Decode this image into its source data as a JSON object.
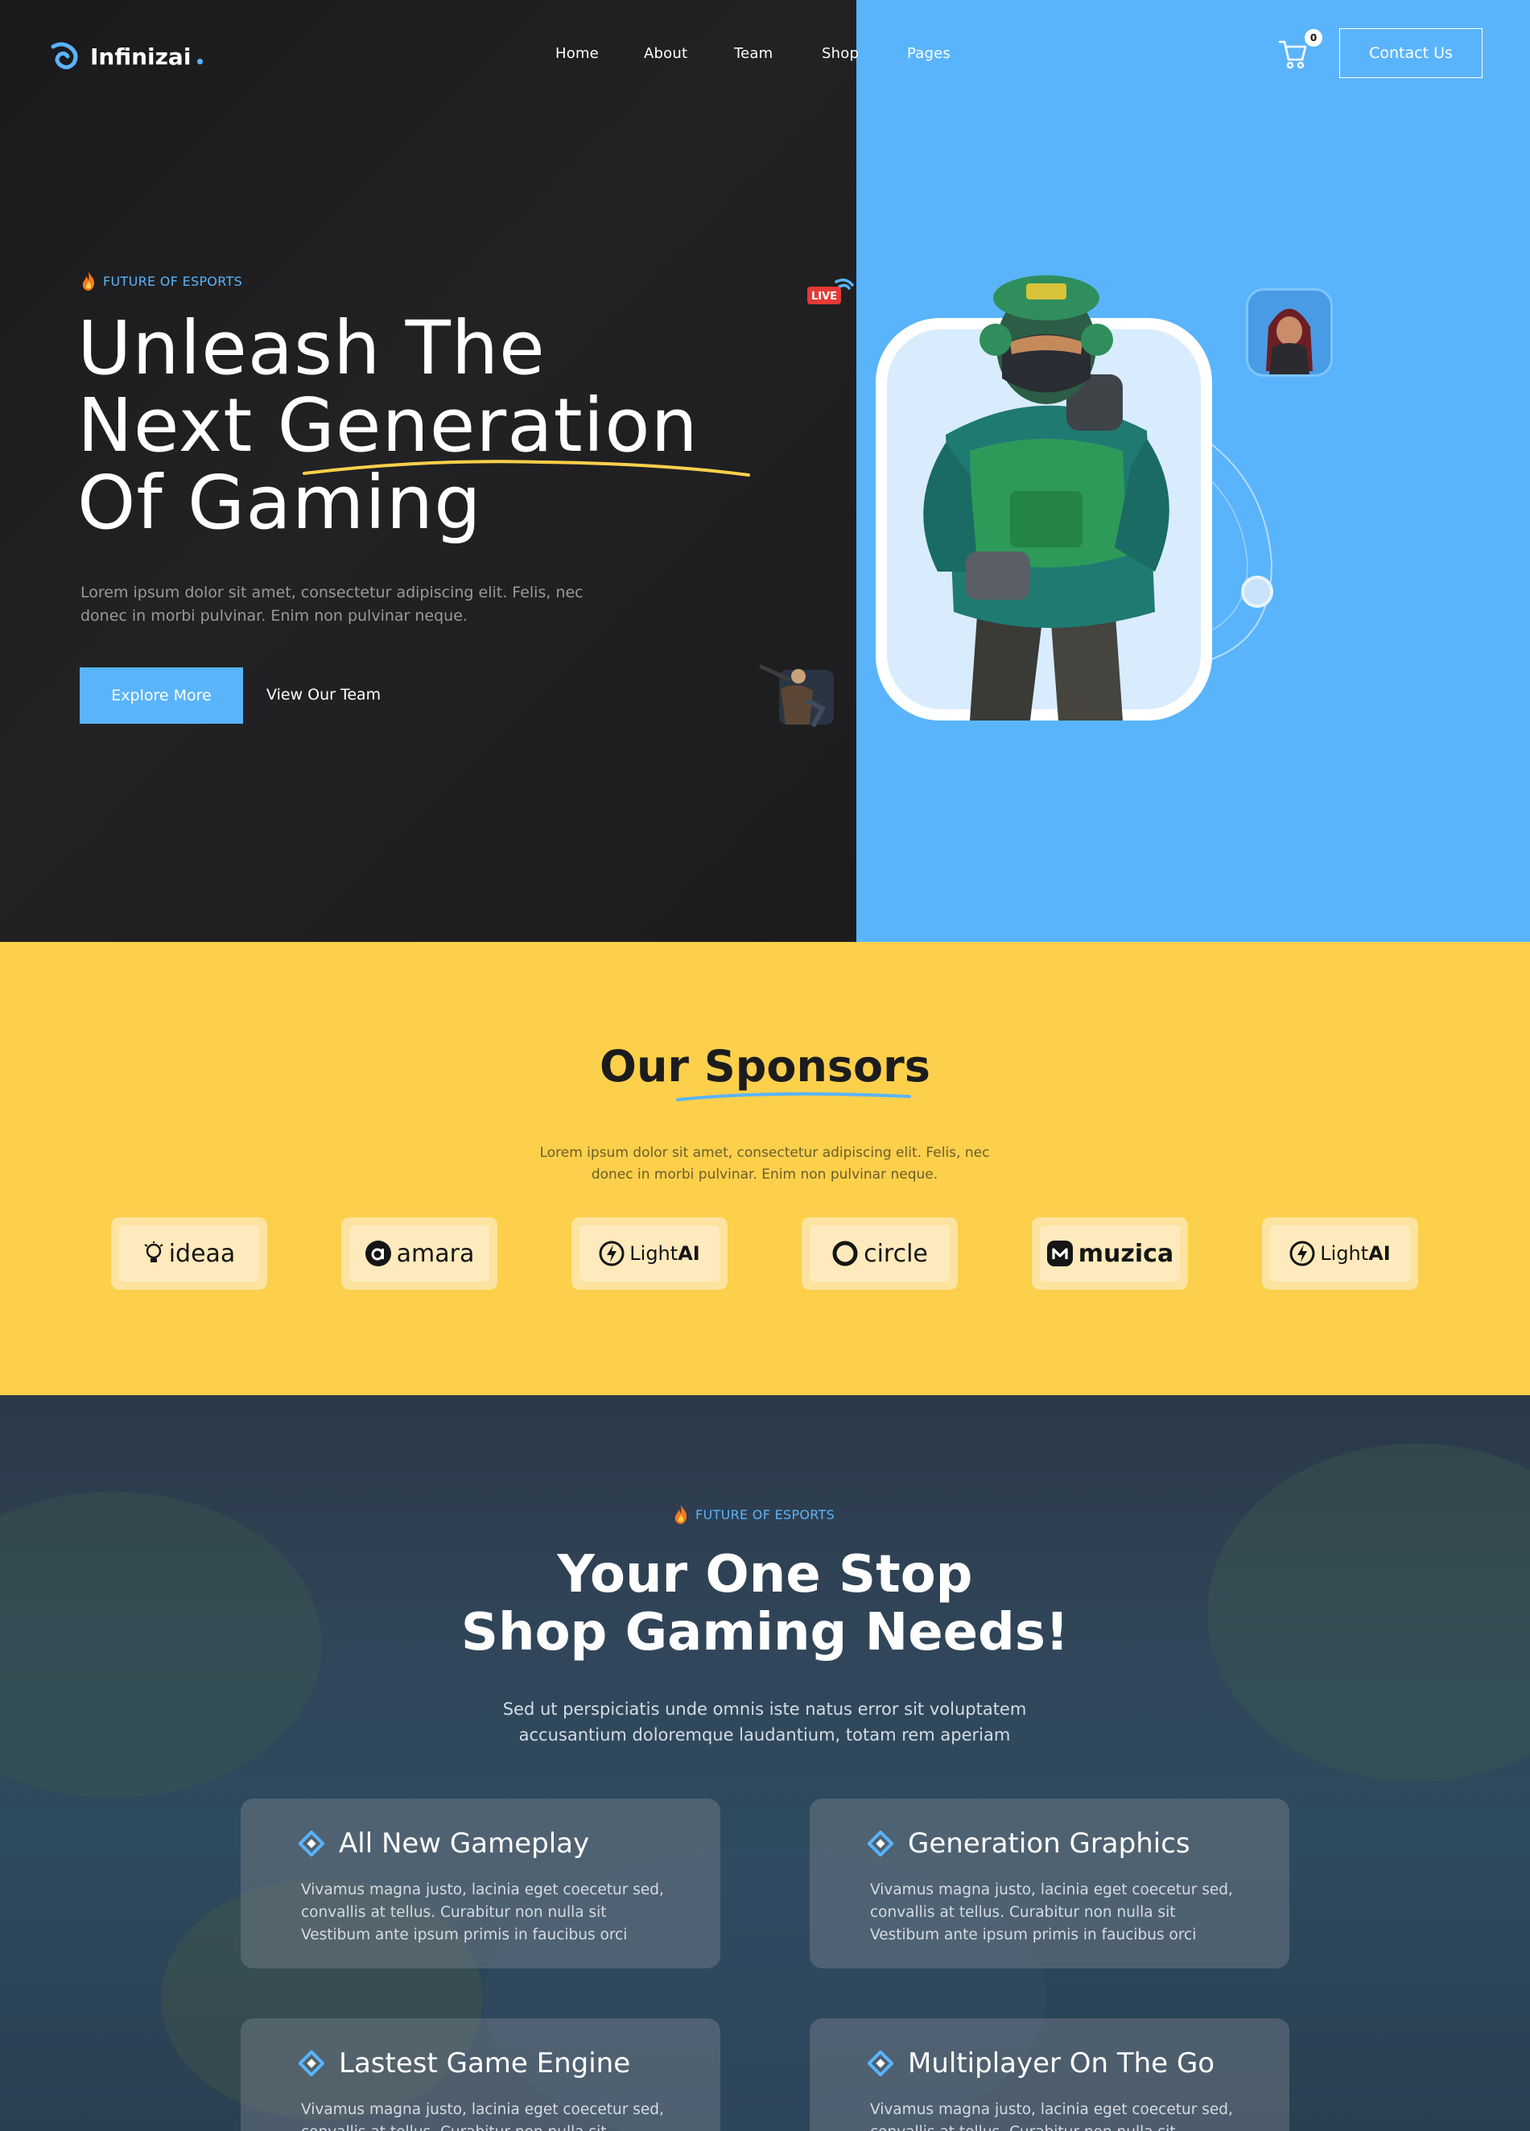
{
  "header": {
    "brand": "Infinizai",
    "nav": [
      "Home",
      "About",
      "Team",
      "Shop",
      "Pages"
    ],
    "cart_count": "0",
    "contact_label": "Contact Us"
  },
  "hero": {
    "eyebrow": "FUTURE OF ESPORTS",
    "title_line1": "Unleash The",
    "title_line2a": "Next ",
    "title_line2b": "Generation",
    "title_line3": "Of Gaming",
    "description": "Lorem ipsum dolor sit amet, consectetur adipiscing elit. Felis, nec donec in morbi pulvinar. Enim non pulvinar neque.",
    "primary_button": "Explore More",
    "secondary_button": "View Our Team",
    "live_label": "LIVE"
  },
  "sponsors": {
    "title": "Our Sponsors",
    "description": "Lorem ipsum dolor sit amet, consectetur adipiscing elit. Felis, nec donec in morbi pulvinar. Enim non pulvinar neque.",
    "logos": [
      {
        "name": "ideaa",
        "icon": "lightbulb-icon"
      },
      {
        "name": "amara",
        "icon": "amara-a-icon"
      },
      {
        "name_light": "Light",
        "name_bold": "AI",
        "icon": "bolt-circle-icon"
      },
      {
        "name": "circle",
        "icon": "ring-icon"
      },
      {
        "name": "muzica",
        "icon": "muzica-m-icon"
      },
      {
        "name_light": "Light",
        "name_bold": "AI",
        "icon": "bolt-circle-icon"
      }
    ]
  },
  "features": {
    "eyebrow": "FUTURE OF ESPORTS",
    "title_line1": "Your One Stop",
    "title_line2": "Shop Gaming Needs!",
    "description": "Sed ut perspiciatis unde omnis iste natus error sit voluptatem accusantium doloremque laudantium, totam rem aperiam",
    "cards": [
      {
        "title": "All New Gameplay",
        "text": "Vivamus magna justo, lacinia eget coecetur sed, convallis at tellus. Curabitur non nulla sit Vestibum ante ipsum primis in faucibus orci"
      },
      {
        "title": "Generation Graphics",
        "text": "Vivamus magna justo, lacinia eget coecetur sed, convallis at tellus. Curabitur non nulla sit Vestibum ante ipsum primis in faucibus orci"
      },
      {
        "title": "Lastest Game Engine",
        "text": "Vivamus magna justo, lacinia eget coecetur sed, convallis at tellus. Curabitur non nulla sit Vestibum ante ipsum primis in faucibus orci"
      },
      {
        "title": "Multiplayer On The Go",
        "text": "Vivamus magna justo, lacinia eget coecetur sed, convallis at tellus. Curabitur non nulla sit Vestibum ante ipsum primis in faucibus orci"
      }
    ]
  },
  "colors": {
    "accent_blue": "#5ab4fb",
    "accent_yellow": "#fcd04b",
    "dark_bg": "#1c1c1e"
  }
}
